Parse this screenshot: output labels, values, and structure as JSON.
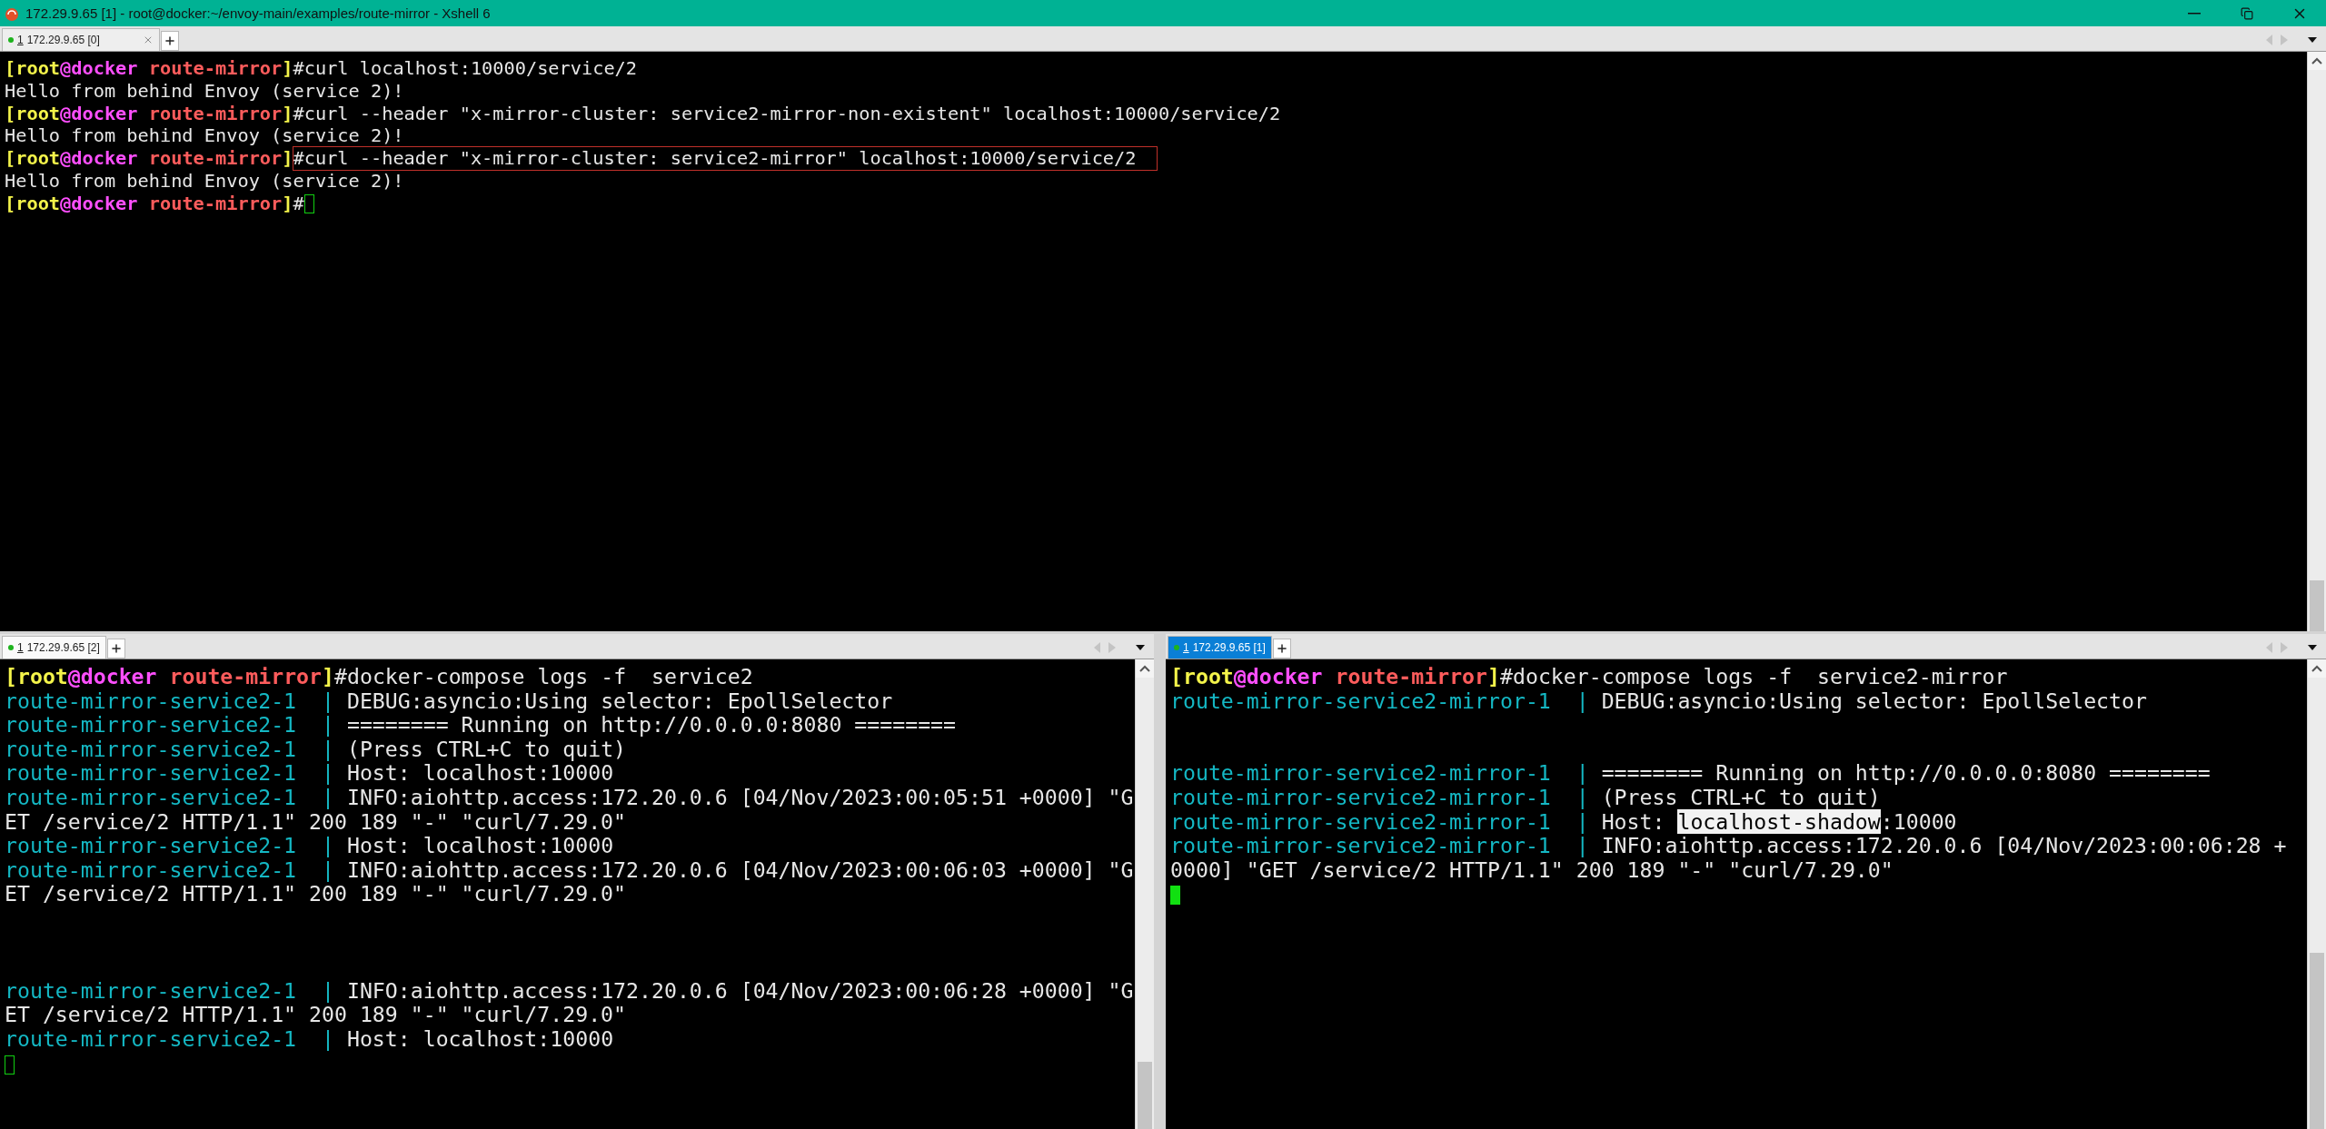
{
  "window": {
    "title": "172.29.9.65 [1] - root@docker:~/envoy-main/examples/route-mirror - Xshell 6"
  },
  "panes": [
    {
      "focused": false,
      "tabs": [
        {
          "number": "1",
          "label": "172.29.9.65 [0]",
          "selected": false,
          "closable": true
        }
      ],
      "lines": [
        {
          "kind": "prompt",
          "open": "[",
          "user": "root",
          "host": "@docker",
          "dir": "route-mirror",
          "close": "]",
          "command": "#curl localhost:10000/service/2",
          "boxed": false
        },
        {
          "kind": "output",
          "text": "Hello from behind Envoy (service 2)!"
        },
        {
          "kind": "prompt",
          "open": "[",
          "user": "root",
          "host": "@docker",
          "dir": "route-mirror",
          "close": "]",
          "command": "#curl --header \"x-mirror-cluster: service2-mirror-non-existent\" localhost:10000/service/2",
          "boxed": false
        },
        {
          "kind": "output",
          "text": "Hello from behind Envoy (service 2)!"
        },
        {
          "kind": "prompt",
          "open": "[",
          "user": "root",
          "host": "@docker",
          "dir": "route-mirror",
          "close": "]",
          "command": "#curl --header \"x-mirror-cluster: service2-mirror\" localhost:10000/service/2",
          "boxed": true
        },
        {
          "kind": "output",
          "text": "Hello from behind Envoy (service 2)!"
        },
        {
          "kind": "prompt",
          "open": "[",
          "user": "root",
          "host": "@docker",
          "dir": "route-mirror",
          "close": "]",
          "command": "#",
          "boxed": false,
          "cursor": true
        }
      ]
    },
    {
      "focused": false,
      "tabs": [
        {
          "number": "1",
          "label": "172.29.9.65 [2]",
          "selected": false,
          "closable": false
        }
      ],
      "lines": [
        {
          "kind": "prompt",
          "open": "[",
          "user": "root",
          "host": "@docker",
          "dir": "route-mirror",
          "close": "]",
          "command": "#docker-compose logs -f  service2",
          "boxed": false
        },
        {
          "kind": "log",
          "source": "route-mirror-service2-1  |",
          "message": " DEBUG:asyncio:Using selector: EpollSelector"
        },
        {
          "kind": "log",
          "source": "route-mirror-service2-1  |",
          "message": " ======== Running on http://0.0.0.0:8080 ========"
        },
        {
          "kind": "log",
          "source": "route-mirror-service2-1  |",
          "message": " (Press CTRL+C to quit)"
        },
        {
          "kind": "log",
          "source": "route-mirror-service2-1  |",
          "message": " Host: localhost:10000"
        },
        {
          "kind": "log",
          "source": "route-mirror-service2-1  |",
          "message": " INFO:aiohttp.access:172.20.0.6 [04/Nov/2023:00:05:51 +0000] \"G"
        },
        {
          "kind": "output",
          "text": "ET /service/2 HTTP/1.1\" 200 189 \"-\" \"curl/7.29.0\""
        },
        {
          "kind": "log",
          "source": "route-mirror-service2-1  |",
          "message": " Host: localhost:10000"
        },
        {
          "kind": "log",
          "source": "route-mirror-service2-1  |",
          "message": " INFO:aiohttp.access:172.20.0.6 [04/Nov/2023:00:06:03 +0000] \"G"
        },
        {
          "kind": "output",
          "text": "ET /service/2 HTTP/1.1\" 200 189 \"-\" \"curl/7.29.0\""
        },
        {
          "kind": "blank"
        },
        {
          "kind": "blank"
        },
        {
          "kind": "blank"
        },
        {
          "kind": "log",
          "source": "route-mirror-service2-1  |",
          "message": " INFO:aiohttp.access:172.20.0.6 [04/Nov/2023:00:06:28 +0000] \"G"
        },
        {
          "kind": "output",
          "text": "ET /service/2 HTTP/1.1\" 200 189 \"-\" \"curl/7.29.0\""
        },
        {
          "kind": "log",
          "source": "route-mirror-service2-1  |",
          "message": " Host: localhost:10000"
        },
        {
          "kind": "cursor"
        }
      ]
    },
    {
      "focused": true,
      "tabs": [
        {
          "number": "1",
          "label": "172.29.9.65 [1]",
          "selected": true,
          "closable": false
        }
      ],
      "lines": [
        {
          "kind": "prompt",
          "open": "[",
          "user": "root",
          "host": "@docker",
          "dir": "route-mirror",
          "close": "]",
          "command": "#docker-compose logs -f  service2-mirror",
          "boxed": false
        },
        {
          "kind": "log",
          "source": "route-mirror-service2-mirror-1  |",
          "message": " DEBUG:asyncio:Using selector: EpollSelector"
        },
        {
          "kind": "blank"
        },
        {
          "kind": "blank"
        },
        {
          "kind": "log",
          "source": "route-mirror-service2-mirror-1  |",
          "message": " ======== Running on http://0.0.0.0:8080 ========"
        },
        {
          "kind": "log",
          "source": "route-mirror-service2-mirror-1  |",
          "message": " (Press CTRL+C to quit)"
        },
        {
          "kind": "log",
          "source": "route-mirror-service2-mirror-1  |",
          "message": " Host: ",
          "selection": "localhost-shadow",
          "message_end": ":10000"
        },
        {
          "kind": "log",
          "source": "route-mirror-service2-mirror-1  |",
          "message": " INFO:aiohttp.access:172.20.0.6 [04/Nov/2023:00:06:28 +"
        },
        {
          "kind": "output",
          "text": "0000] \"GET /service/2 HTTP/1.1\" 200 189 \"-\" \"curl/7.29.0\""
        },
        {
          "kind": "cursor"
        }
      ]
    }
  ]
}
